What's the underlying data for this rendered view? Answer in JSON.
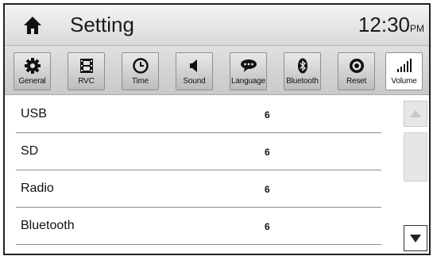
{
  "header": {
    "title": "Setting",
    "time": "12:30",
    "ampm": "PM"
  },
  "tabs": [
    {
      "label": "General",
      "icon": "gear-icon"
    },
    {
      "label": "RVC",
      "icon": "film-icon"
    },
    {
      "label": "Time",
      "icon": "clock-icon"
    },
    {
      "label": "Sound",
      "icon": "speaker-icon"
    },
    {
      "label": "Language",
      "icon": "speech-bubble-icon"
    },
    {
      "label": "Bluetooth",
      "icon": "bluetooth-icon"
    },
    {
      "label": "Reset",
      "icon": "reset-icon"
    },
    {
      "label": "Volume",
      "icon": "volume-bars-icon",
      "active": true
    }
  ],
  "volume_list": [
    {
      "name": "USB",
      "value": "6"
    },
    {
      "name": "SD",
      "value": "6"
    },
    {
      "name": "Radio",
      "value": "6"
    },
    {
      "name": "Bluetooth",
      "value": "6"
    }
  ],
  "colors": {
    "header_bg": "#e6e6e6",
    "tabbar_bg": "#d2d2d2",
    "active_tab": "#ffffff",
    "divider": "#8d8d8d"
  }
}
